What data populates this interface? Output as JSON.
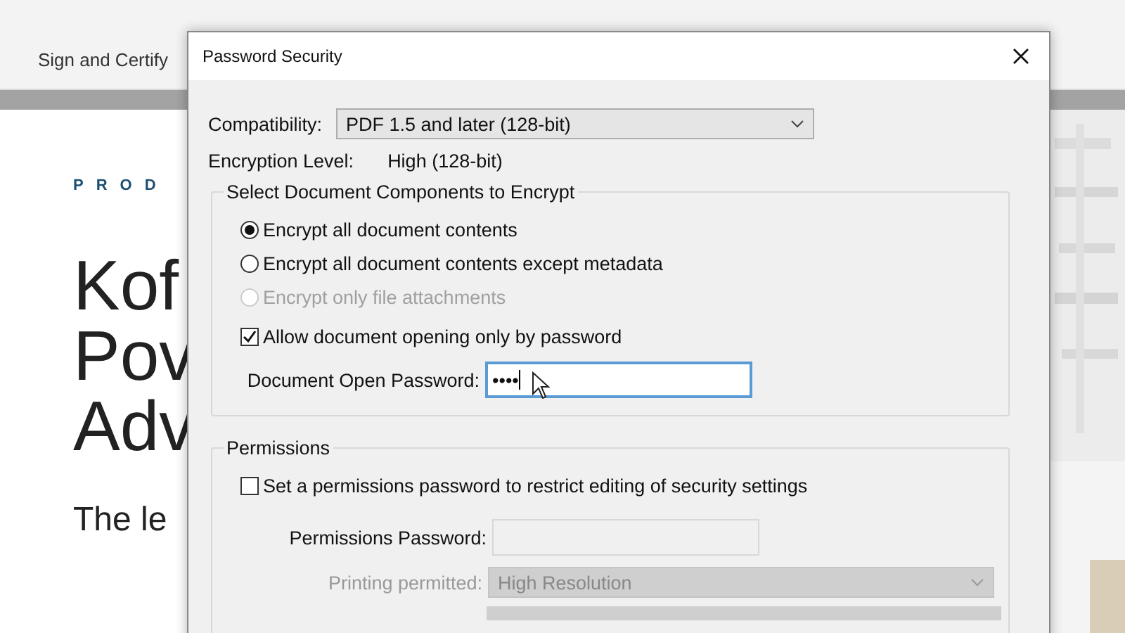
{
  "ribbon": {
    "items": [
      {
        "label": "Sign and Certify"
      }
    ]
  },
  "page": {
    "eyebrow": "PROD",
    "headline": [
      "Kof",
      "Pov",
      "Adv"
    ],
    "lede": "The le"
  },
  "dialog": {
    "title": "Password Security",
    "compatibility": {
      "label": "Compatibility:",
      "value": "PDF 1.5 and later (128-bit)"
    },
    "encryption_level": {
      "label": "Encryption Level:",
      "value": "High (128-bit)"
    },
    "components": {
      "title": "Select Document Components to Encrypt",
      "options": [
        {
          "label": "Encrypt all document contents",
          "selected": true,
          "disabled": false
        },
        {
          "label": "Encrypt all document contents except metadata",
          "selected": false,
          "disabled": false
        },
        {
          "label": "Encrypt only file attachments",
          "selected": false,
          "disabled": true
        }
      ],
      "open_password_checkbox": {
        "label": "Allow document opening only by password",
        "checked": true
      },
      "open_password": {
        "label": "Document Open Password:",
        "value": "••••"
      }
    },
    "permissions": {
      "title": "Permissions",
      "restrict_checkbox": {
        "label": "Set a permissions password to restrict editing of security settings",
        "checked": false
      },
      "permissions_password": {
        "label": "Permissions Password:",
        "disabled": true
      },
      "printing": {
        "label": "Printing permitted:",
        "value": "High Resolution",
        "disabled": true
      }
    }
  }
}
